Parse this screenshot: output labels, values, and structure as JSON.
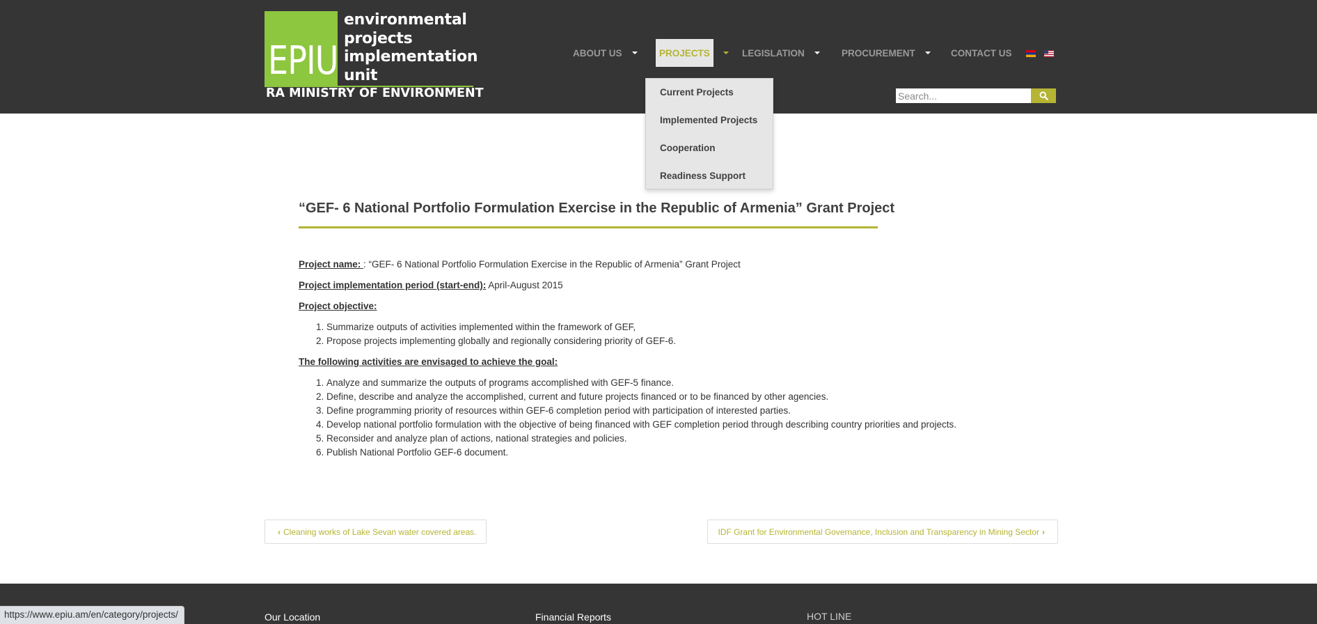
{
  "logo": {
    "badge": "EPIU",
    "words": [
      "environmental",
      "projects",
      "implementation",
      "unit"
    ],
    "ministry": "RA MINISTRY OF ENVIRONMENT",
    "brand_color": "#8dc63f"
  },
  "nav": {
    "items": [
      {
        "label": "ABOUT US",
        "has_caret": true
      },
      {
        "label": "PROJECTS",
        "has_caret": true,
        "active": true
      },
      {
        "label": "LEGISLATION",
        "has_caret": true
      },
      {
        "label": "PROCUREMENT",
        "has_caret": true
      },
      {
        "label": "CONTACT US",
        "has_caret": false
      }
    ],
    "flags": [
      "armenian-flag-icon",
      "us-flag-icon"
    ],
    "accent_color": "#b5b434"
  },
  "search": {
    "placeholder": "Search...",
    "icon": "search-icon"
  },
  "dropdown": {
    "items": [
      "Current Projects",
      "Implemented Projects",
      "Cooperation",
      "Readiness Support"
    ]
  },
  "article": {
    "title": "“GEF- 6 National Portfolio Formulation Exercise in the Republic of Armenia” Grant Project",
    "project_name_label": "Project name: ",
    "project_name_value": ": “GEF- 6 National Portfolio Formulation Exercise in the Republic of Armenia” Grant Project",
    "period_label": "Project implementation period (start-end):",
    "period_value": " April-August 2015",
    "objective_label": "Project objective: ",
    "objectives": [
      "Summarize outputs of activities implemented within the framework of GEF,",
      "Propose projects implementing globally and regionally considering priority of GEF-6."
    ],
    "activities_label": "The following activities are envisaged to achieve the goal:",
    "activities": [
      "Analyze and summarize the outputs of programs accomplished with GEF-5 finance.",
      "Define, describe and analyze the accomplished, current and future projects financed or to be financed by other agencies.",
      "Define programming priority of resources within GEF-6 completion period with participation of interested parties.",
      "Develop national portfolio formulation with the objective of being financed with GEF completion period through describing country priorities and projects.",
      "Reconsider and analyze plan of actions, national strategies and policies.",
      "Publish National Portfolio GEF-6 document."
    ]
  },
  "pager": {
    "prev": "Cleaning works of Lake Sevan water covered areas.",
    "next": "IDF Grant for Environmental Governance, Inclusion and Transparency in Mining Sector"
  },
  "footer": {
    "col1": "Our Location",
    "col2": "Financial Reports",
    "col3": "HOT LINE"
  },
  "statusbar": {
    "url": "https://www.epiu.am/en/category/projects/"
  }
}
